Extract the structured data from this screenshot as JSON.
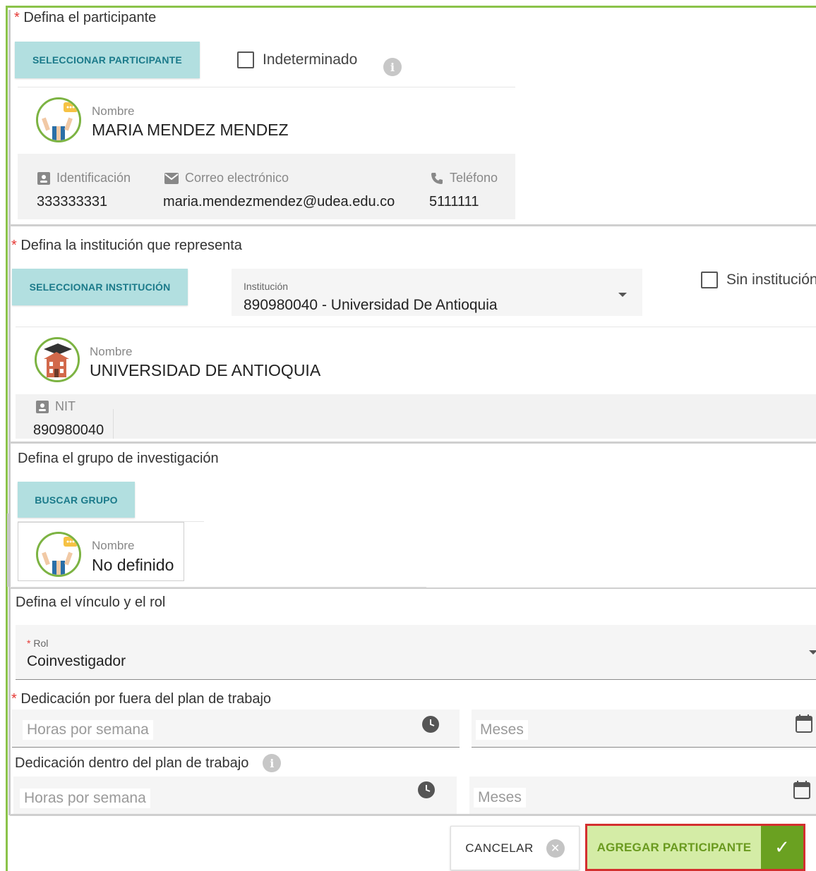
{
  "participant": {
    "section_title": "Defina el participante",
    "select_button": "SELECCIONAR PARTICIPANTE",
    "undetermined_label": "Indeterminado",
    "name_label": "Nombre",
    "name": "MARIA MENDEZ MENDEZ",
    "id_label": "Identificación",
    "id_value": "333333331",
    "email_label": "Correo electrónico",
    "email_value": "maria.mendezmendez@udea.edu.co",
    "phone_label": "Teléfono",
    "phone_value": "5111111"
  },
  "institution": {
    "section_title": "Defina la institución que representa",
    "select_button": "SELECCIONAR INSTITUCIÓN",
    "field_label": "Institución",
    "field_value": "890980040 - Universidad De Antioquia",
    "no_institution_label": "Sin institución",
    "name_label": "Nombre",
    "name": "UNIVERSIDAD DE ANTIOQUIA",
    "nit_label": "NIT",
    "nit_value": "890980040"
  },
  "group": {
    "section_title": "Defina el grupo de investigación",
    "search_button": "BUSCAR GRUPO",
    "name_label": "Nombre",
    "name": "No definido"
  },
  "role": {
    "section_title": "Defina el vínculo y el rol",
    "field_label": "Rol",
    "field_value": "Coinvestigador"
  },
  "dedication_outside": {
    "section_title": "Dedicación por fuera del plan de trabajo",
    "hours_placeholder": "Horas por semana",
    "months_placeholder": "Meses"
  },
  "dedication_inside": {
    "section_title": "Dedicación dentro del plan de trabajo",
    "hours_placeholder": "Horas por semana",
    "months_placeholder": "Meses"
  },
  "actions": {
    "cancel_label": "CANCELAR",
    "add_label": "AGREGAR PARTICIPANTE"
  },
  "colors": {
    "accent_green": "#8bc34a",
    "teal_button": "#b2dfe0",
    "required_red": "#e53935",
    "add_button_border": "#d32f2f"
  }
}
